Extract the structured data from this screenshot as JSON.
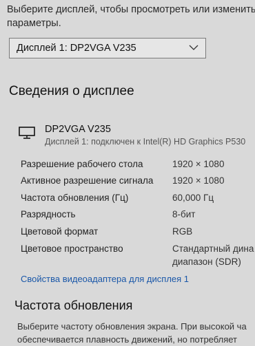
{
  "intro": {
    "line1": "Выберите дисплей, чтобы просмотреть или изменить",
    "line2": "параметры."
  },
  "display_select": {
    "selected": "Дисплей 1: DP2VGA V235"
  },
  "section_title": "Сведения о дисплее",
  "device": {
    "name": "DP2VGA V235",
    "subtitle": "Дисплей 1: подключен к Intel(R) HD Graphics P530"
  },
  "info_rows": [
    {
      "label": "Разрешение рабочего стола",
      "value": "1920 × 1080"
    },
    {
      "label": "Активное разрешение сигнала",
      "value": "1920 × 1080"
    },
    {
      "label": "Частота обновления (Гц)",
      "value": "60,000 Гц"
    },
    {
      "label": "Разрядность",
      "value": "8-бит"
    },
    {
      "label": "Цветовой формат",
      "value": "RGB"
    },
    {
      "label": "Цветовое пространство",
      "value": "Стандартный дина",
      "value_line2": "диапазон (SDR)"
    }
  ],
  "adapter_link": "Свойства видеоадаптера для дисплея 1",
  "refresh": {
    "title": "Частота обновления",
    "desc_line1": "Выберите частоту обновления экрана. При высокой ча",
    "desc_line2": "обеспечивается плавность движений, но потребляет"
  },
  "icons": {
    "chevron": "chevron-down-icon",
    "monitor": "monitor-icon"
  }
}
